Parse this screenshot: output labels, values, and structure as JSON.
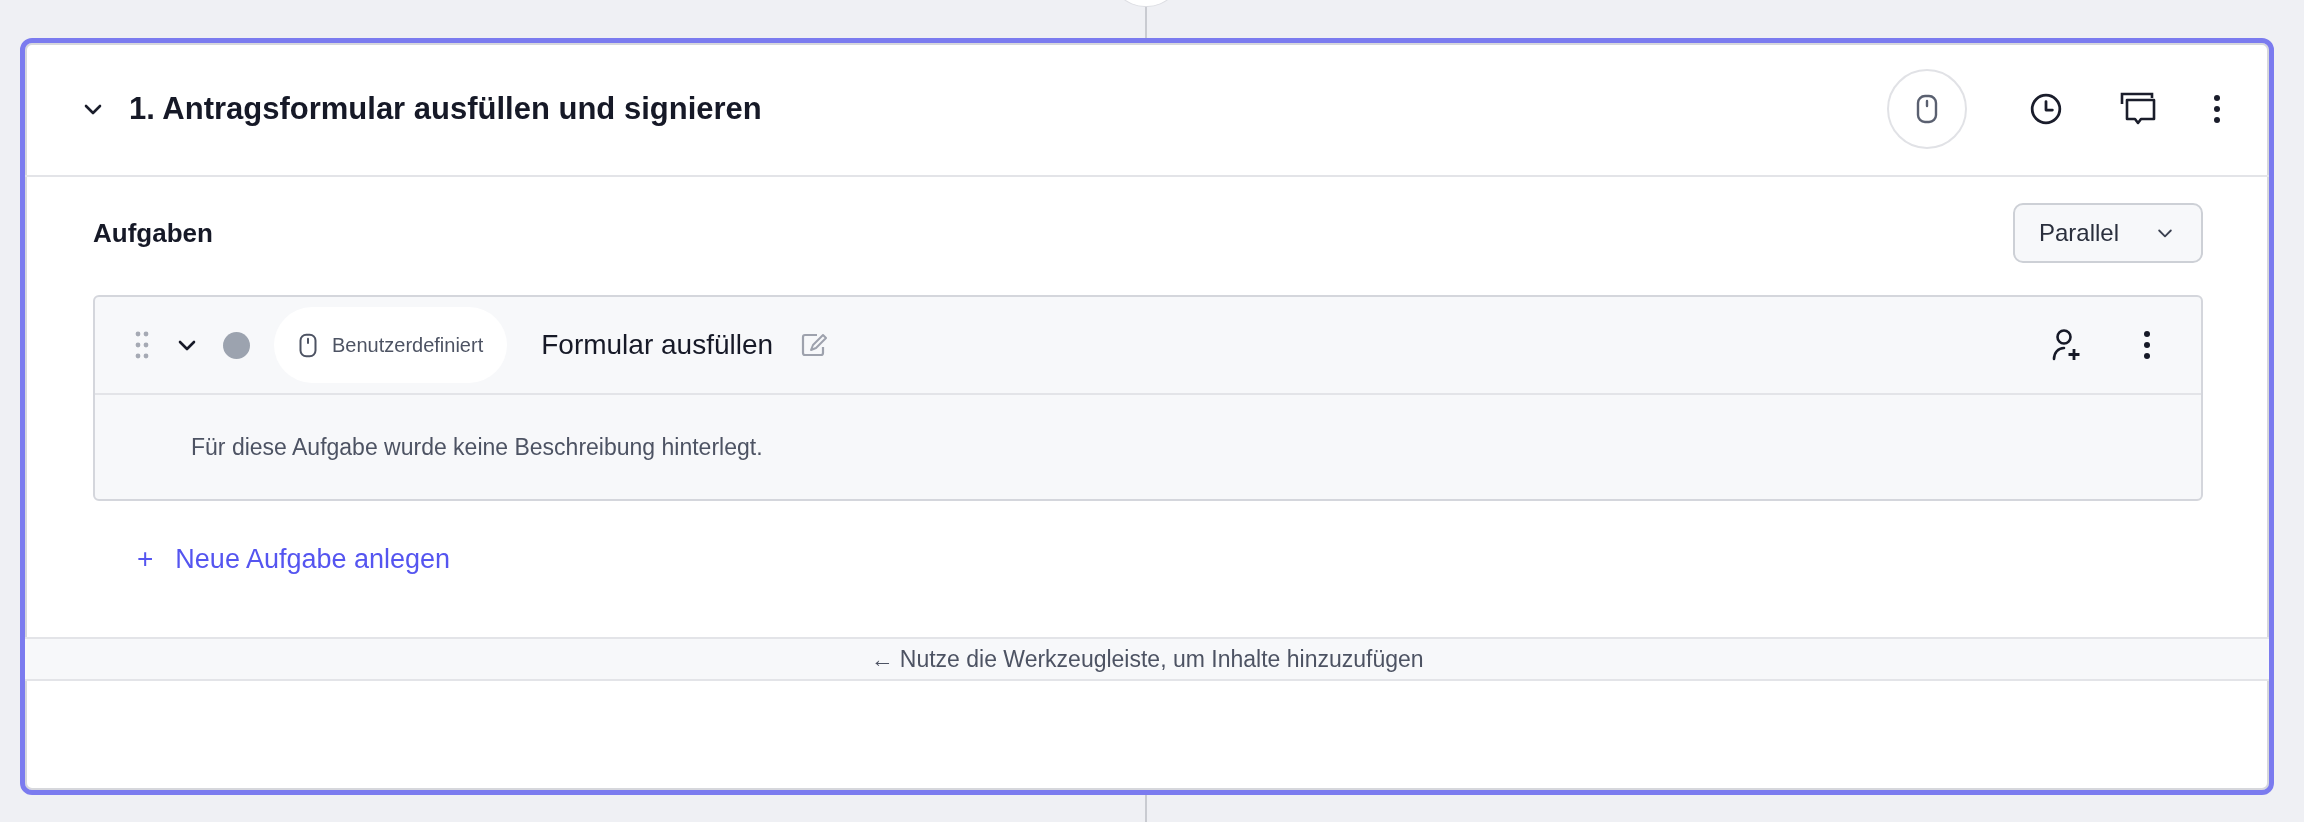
{
  "step": {
    "title": "1. Antragsformular ausfüllen und signieren",
    "expanded": true
  },
  "section": {
    "title": "Aufgaben",
    "mode_dropdown": "Parallel"
  },
  "tasks": [
    {
      "expanded": true,
      "color": "#9ca3af",
      "type_label": "Benutzerdefiniert",
      "name": "Formular ausfüllen",
      "description": "Für diese Aufgabe wurde keine Beschreibung hinterlegt."
    }
  ],
  "add_task": {
    "icon": "+",
    "label": "Neue Aufgabe anlegen"
  },
  "hint": "← Nutze die Werkzeugleiste, um Inhalte hinzuzufügen"
}
